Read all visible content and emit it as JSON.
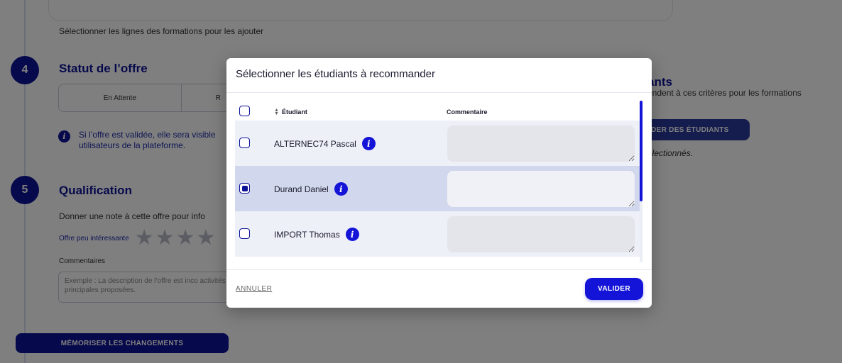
{
  "background": {
    "top_hint": "Sélectionner les lignes des formations pour les ajouter",
    "step4": {
      "number": "4",
      "title": "Statut de l’offre",
      "status_options": [
        "En Attente",
        "R"
      ],
      "info_text": "Si l’offre est validée, elle sera visible utilisateurs de la plateforme."
    },
    "step5": {
      "number": "5",
      "title": "Qualification",
      "description": "Donner une note à cette offre pour info",
      "rating_label": "Offre peu intéressante",
      "stars": [
        "★",
        "★",
        "★",
        "★"
      ],
      "comment_label": "Commentaires",
      "comment_placeholder": "Exemple : La description de l’offre est inco activités principales proposées."
    },
    "right_panel": {
      "title": "ants",
      "description": "ondent à ces critères pour les formations",
      "button_label": "IDER DES ÉTUDIANTS",
      "note": "électionnés."
    },
    "save_button": "MÉMORISER LES CHANGEMENTS"
  },
  "modal": {
    "title": "Sélectionner les étudiants à recommander",
    "columns": {
      "student": "Étudiant",
      "comment": "Commentaire"
    },
    "rows": [
      {
        "name": "ALTERNEC74 Pascal",
        "checked": false,
        "comment": ""
      },
      {
        "name": "Durand Daniel",
        "checked": true,
        "comment": ""
      },
      {
        "name": "IMPORT Thomas",
        "checked": false,
        "comment": ""
      }
    ],
    "info_glyph": "i",
    "cancel_label": "ANNULER",
    "validate_label": "VALIDER"
  },
  "colors": {
    "primary": "#0c1296",
    "accent": "#1414d8",
    "selected_row": "#d1d7ec",
    "row": "#eef0f8"
  }
}
